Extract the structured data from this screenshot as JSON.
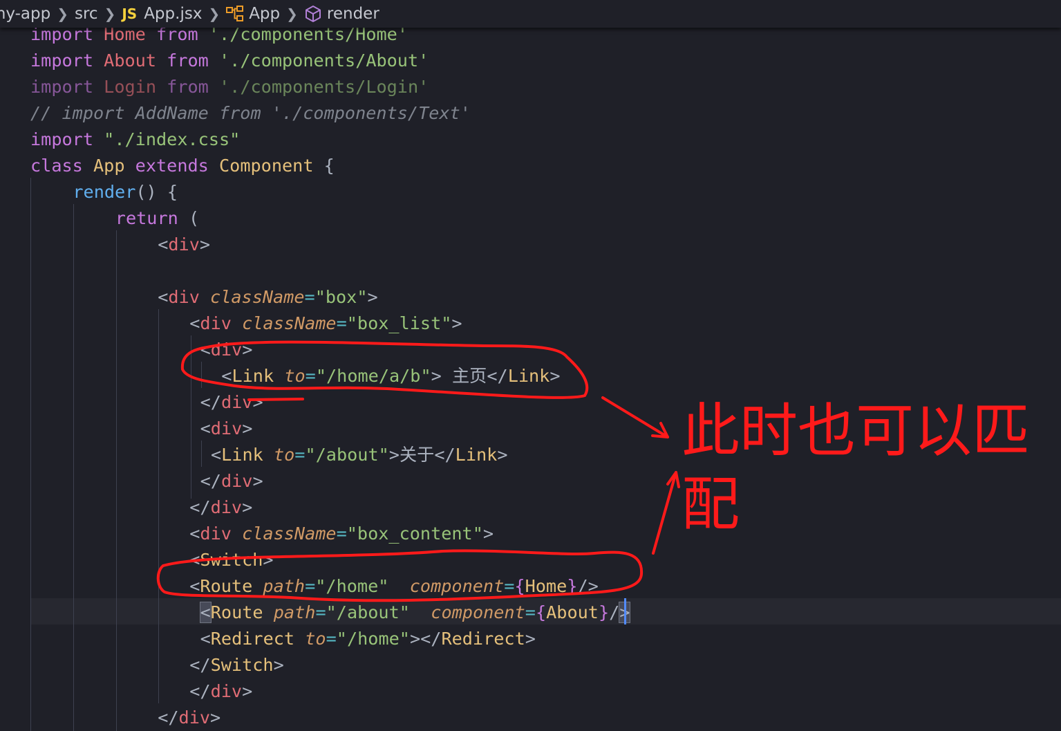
{
  "breadcrumb": {
    "items": [
      "my-app",
      "src",
      "App.jsx",
      "App",
      "render"
    ],
    "file_badge": "JS"
  },
  "editor": {
    "lines": [
      [
        [
          "kw",
          "import"
        ],
        [
          "pun",
          " "
        ],
        [
          "ident",
          "Home"
        ],
        [
          "pun",
          " "
        ],
        [
          "kw",
          "from"
        ],
        [
          "pun",
          " "
        ],
        [
          "str",
          "'./components/Home'"
        ]
      ],
      [
        [
          "kw",
          "import"
        ],
        [
          "pun",
          " "
        ],
        [
          "ident",
          "About"
        ],
        [
          "pun",
          " "
        ],
        [
          "kw",
          "from"
        ],
        [
          "pun",
          " "
        ],
        [
          "str",
          "'./components/About'"
        ]
      ],
      [
        [
          "kw dim",
          "import"
        ],
        [
          "pun dim",
          " "
        ],
        [
          "ident dim",
          "Login"
        ],
        [
          "pun dim",
          " "
        ],
        [
          "kw dim",
          "from"
        ],
        [
          "pun dim",
          " "
        ],
        [
          "str dim",
          "'./components/Login'"
        ]
      ],
      [
        [
          "cmt",
          "// import AddName from './components/Text'"
        ]
      ],
      [
        [
          "kw",
          "import"
        ],
        [
          "pun",
          " "
        ],
        [
          "str",
          "\"./index.css\""
        ]
      ],
      [
        [
          "kw",
          "class"
        ],
        [
          "pun",
          " "
        ],
        [
          "cls",
          "App"
        ],
        [
          "pun",
          " "
        ],
        [
          "kw",
          "extends"
        ],
        [
          "pun",
          " "
        ],
        [
          "cls",
          "Component"
        ],
        [
          "pun",
          " {"
        ]
      ],
      [
        [
          "pun",
          "    "
        ],
        [
          "fn",
          "render"
        ],
        [
          "pun",
          "() {"
        ]
      ],
      [
        [
          "pun",
          "        "
        ],
        [
          "kw",
          "return"
        ],
        [
          "pun",
          " ("
        ]
      ],
      [
        [
          "pun",
          "            "
        ],
        [
          "pun",
          "<"
        ],
        [
          "tag",
          "div"
        ],
        [
          "pun",
          ">"
        ]
      ],
      [],
      [
        [
          "pun",
          "            "
        ],
        [
          "pun",
          "<"
        ],
        [
          "tag",
          "div"
        ],
        [
          "pun",
          " "
        ],
        [
          "attr",
          "className"
        ],
        [
          "op",
          "="
        ],
        [
          "str",
          "\"box\""
        ],
        [
          "pun",
          ">"
        ]
      ],
      [
        [
          "pun",
          "               "
        ],
        [
          "pun",
          "<"
        ],
        [
          "tag",
          "div"
        ],
        [
          "pun",
          " "
        ],
        [
          "attr",
          "className"
        ],
        [
          "op",
          "="
        ],
        [
          "str",
          "\"box_list\""
        ],
        [
          "pun",
          ">"
        ]
      ],
      [
        [
          "pun",
          "                "
        ],
        [
          "pun",
          "<"
        ],
        [
          "tag",
          "div"
        ],
        [
          "pun",
          ">"
        ]
      ],
      [
        [
          "pun",
          "                  "
        ],
        [
          "pun",
          "<"
        ],
        [
          "cls",
          "Link"
        ],
        [
          "pun",
          " "
        ],
        [
          "attr",
          "to"
        ],
        [
          "op",
          "="
        ],
        [
          "str",
          "\"/home/a/b\""
        ],
        [
          "pun",
          "> 主页</"
        ],
        [
          "cls",
          "Link"
        ],
        [
          "pun",
          ">"
        ]
      ],
      [
        [
          "pun",
          "                "
        ],
        [
          "pun",
          "</"
        ],
        [
          "tag",
          "div"
        ],
        [
          "pun",
          ">"
        ]
      ],
      [
        [
          "pun",
          "                "
        ],
        [
          "pun",
          "<"
        ],
        [
          "tag",
          "div"
        ],
        [
          "pun",
          ">"
        ]
      ],
      [
        [
          "pun",
          "                 "
        ],
        [
          "pun",
          "<"
        ],
        [
          "cls",
          "Link"
        ],
        [
          "pun",
          " "
        ],
        [
          "attr",
          "to"
        ],
        [
          "op",
          "="
        ],
        [
          "str",
          "\"/about\""
        ],
        [
          "pun",
          ">关于</"
        ],
        [
          "cls",
          "Link"
        ],
        [
          "pun",
          ">"
        ]
      ],
      [
        [
          "pun",
          "                "
        ],
        [
          "pun",
          "</"
        ],
        [
          "tag",
          "div"
        ],
        [
          "pun",
          ">"
        ]
      ],
      [
        [
          "pun",
          "               "
        ],
        [
          "pun",
          "</"
        ],
        [
          "tag",
          "div"
        ],
        [
          "pun",
          ">"
        ]
      ],
      [
        [
          "pun",
          "               "
        ],
        [
          "pun",
          "<"
        ],
        [
          "tag",
          "div"
        ],
        [
          "pun",
          " "
        ],
        [
          "attr",
          "className"
        ],
        [
          "op",
          "="
        ],
        [
          "str",
          "\"box_content\""
        ],
        [
          "pun",
          ">"
        ]
      ],
      [
        [
          "pun",
          "               "
        ],
        [
          "pun",
          "<"
        ],
        [
          "cls",
          "Switch"
        ],
        [
          "pun",
          ">"
        ]
      ],
      [
        [
          "pun",
          "               "
        ],
        [
          "pun",
          "<"
        ],
        [
          "cls",
          "Route"
        ],
        [
          "pun",
          " "
        ],
        [
          "attr",
          "path"
        ],
        [
          "op",
          "="
        ],
        [
          "str",
          "\"/home\""
        ],
        [
          "pun",
          "  "
        ],
        [
          "attr",
          "component"
        ],
        [
          "op",
          "="
        ],
        [
          "kw",
          "{"
        ],
        [
          "cls",
          "Home"
        ],
        [
          "kw",
          "}"
        ],
        [
          "pun",
          "/>"
        ]
      ],
      [
        [
          "pun",
          "                "
        ],
        [
          "pun bm",
          "<"
        ],
        [
          "cls",
          "Route"
        ],
        [
          "pun",
          " "
        ],
        [
          "attr",
          "path"
        ],
        [
          "op",
          "="
        ],
        [
          "str",
          "\"/about\""
        ],
        [
          "pun",
          "  "
        ],
        [
          "attr",
          "component"
        ],
        [
          "op",
          "="
        ],
        [
          "kw",
          "{"
        ],
        [
          "cls",
          "About"
        ],
        [
          "kw",
          "}"
        ],
        [
          "pun",
          "/"
        ],
        [
          "pun bm",
          ">"
        ]
      ],
      [
        [
          "pun",
          "                "
        ],
        [
          "pun",
          "<"
        ],
        [
          "cls",
          "Redirect"
        ],
        [
          "pun",
          " "
        ],
        [
          "attr",
          "to"
        ],
        [
          "op",
          "="
        ],
        [
          "str",
          "\"/home\""
        ],
        [
          "pun",
          "></"
        ],
        [
          "cls",
          "Redirect"
        ],
        [
          "pun",
          ">"
        ]
      ],
      [
        [
          "pun",
          "               "
        ],
        [
          "pun",
          "</"
        ],
        [
          "cls",
          "Switch"
        ],
        [
          "pun",
          ">"
        ]
      ],
      [
        [
          "pun",
          "               "
        ],
        [
          "pun",
          "</"
        ],
        [
          "tag",
          "div"
        ],
        [
          "pun",
          ">"
        ]
      ],
      [
        [
          "pun",
          "            "
        ],
        [
          "pun",
          "</"
        ],
        [
          "tag",
          "div"
        ],
        [
          "pun",
          ">"
        ]
      ]
    ]
  },
  "annotation": {
    "text": "此时也可以匹配",
    "color": "#ff1a1a"
  },
  "colors": {
    "background": "#1f2028",
    "keyword": "#c678dd",
    "string": "#98c379",
    "component": "#e5c07b",
    "tag": "#e06c75",
    "attribute": "#d19a66",
    "function": "#61afef",
    "comment": "#7f848e",
    "cursor": "#528bff"
  }
}
